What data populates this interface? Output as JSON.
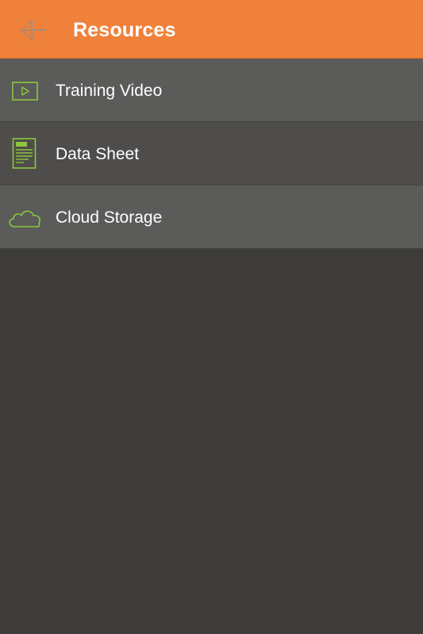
{
  "header": {
    "title": "Resources",
    "back_icon": "dotted-arrow-left-icon",
    "background": "#f0813a"
  },
  "items": [
    {
      "label": "Training Video",
      "icon": "video-play-icon"
    },
    {
      "label": "Data Sheet",
      "icon": "pdf-document-icon"
    },
    {
      "label": "Cloud Storage",
      "icon": "cloud-icon"
    }
  ],
  "colors": {
    "icon_green": "#8cc63f",
    "row_light": "#5b5b59",
    "row_dark": "#4e4d4b",
    "page_background": "#3d3c3a"
  }
}
